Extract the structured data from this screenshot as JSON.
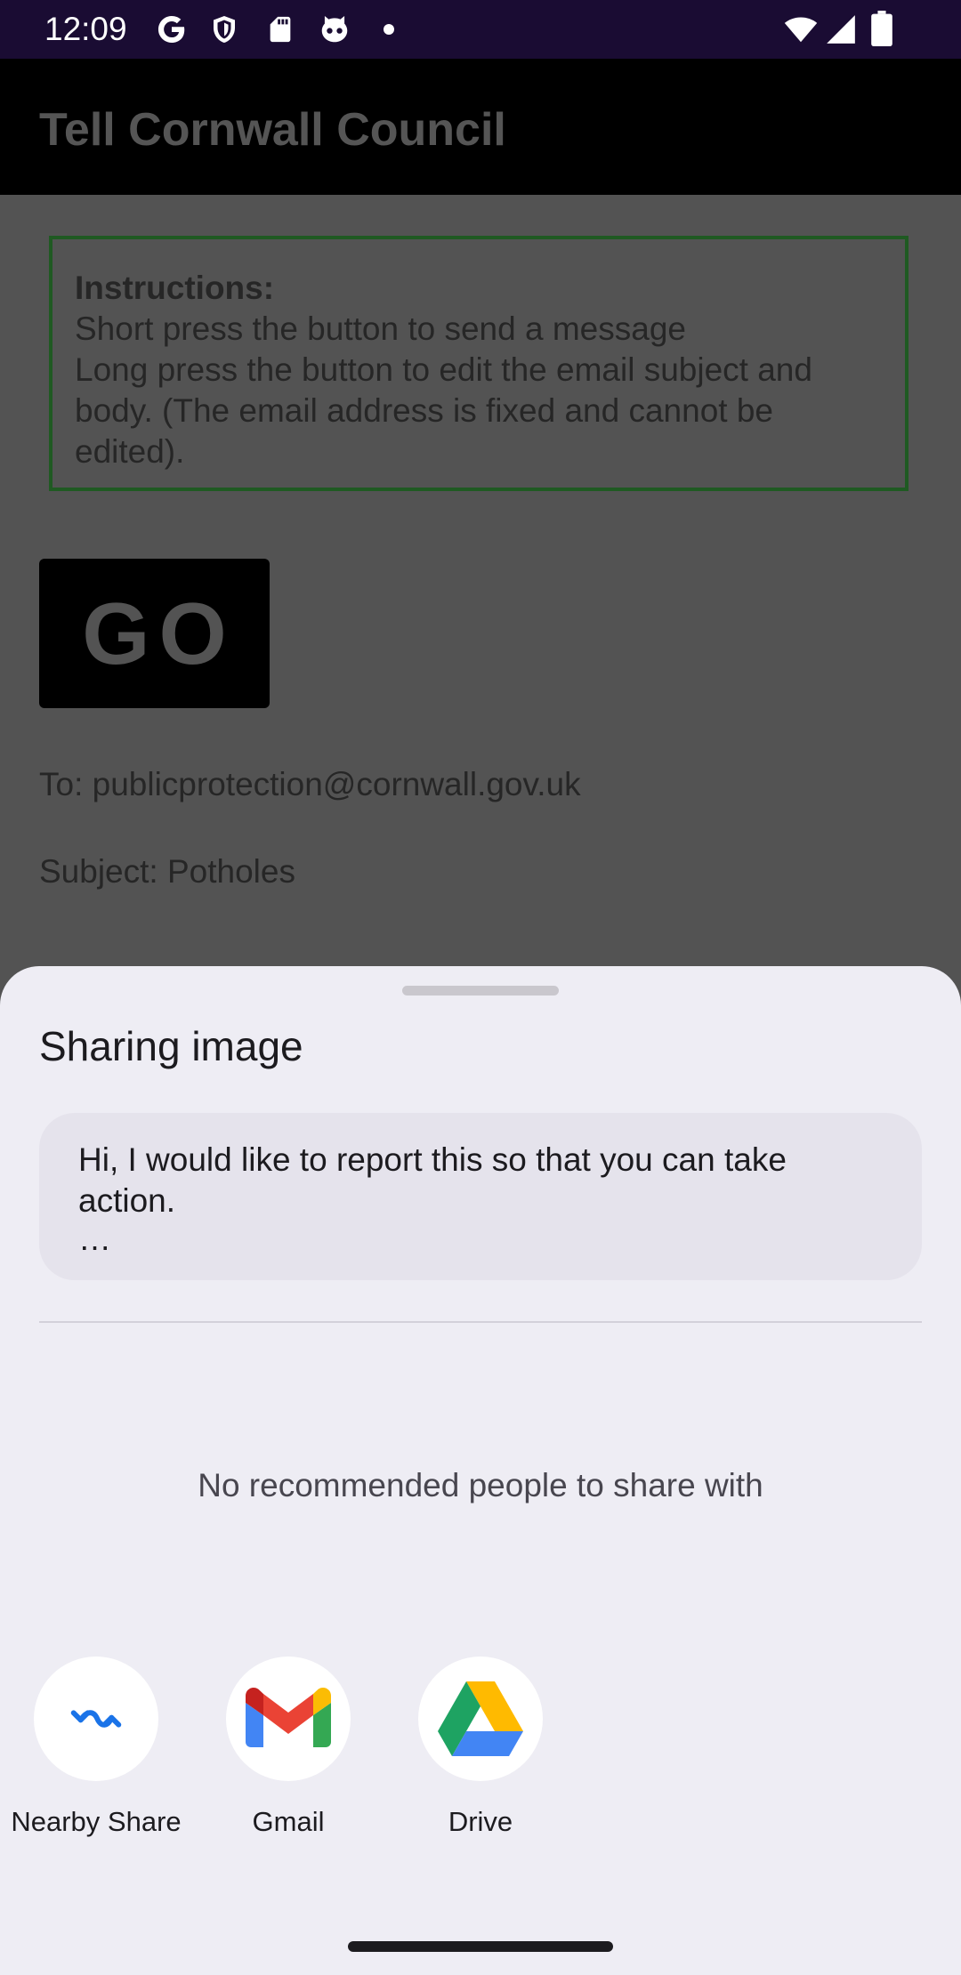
{
  "status_bar": {
    "time": "12:09",
    "icons_left": [
      "google-g-icon",
      "shield-icon",
      "sd-card-icon",
      "cat-face-icon",
      "dot-icon"
    ],
    "icons_right": [
      "wifi-icon",
      "signal-icon",
      "battery-icon"
    ]
  },
  "app_bar": {
    "title": "Tell Cornwall Council"
  },
  "instructions": {
    "heading": "Instructions:",
    "line1": "Short press the button to send a message",
    "line2": "Long press the button to edit the email subject and body. (The email address is fixed and cannot be edited)."
  },
  "go_button": {
    "label": "GO"
  },
  "email": {
    "to": "To: publicprotection@cornwall.gov.uk",
    "subject": "Subject: Potholes"
  },
  "share_sheet": {
    "title": "Sharing image",
    "preview_text": "Hi, I would like to report this so that you can take action.",
    "preview_ellipsis": "…",
    "no_people_text": "No recommended people to share with",
    "targets": [
      {
        "label": "Nearby Share",
        "icon": "nearby-share-icon"
      },
      {
        "label": "Gmail",
        "icon": "gmail-icon"
      },
      {
        "label": "Drive",
        "icon": "drive-icon"
      }
    ]
  },
  "colors": {
    "scrim_background": "#535353",
    "status_bar": "#1a0c33",
    "app_bar": "#000000",
    "instructions_border": "#1f5a22",
    "sheet_background": "#eeedf4",
    "preview_card": "#e5e3ec",
    "nearby_share_blue": "#1a73e8",
    "gmail_red": "#ea4335",
    "drive_green": "#1ea362",
    "drive_yellow": "#ffba00",
    "drive_blue": "#4285f4"
  }
}
